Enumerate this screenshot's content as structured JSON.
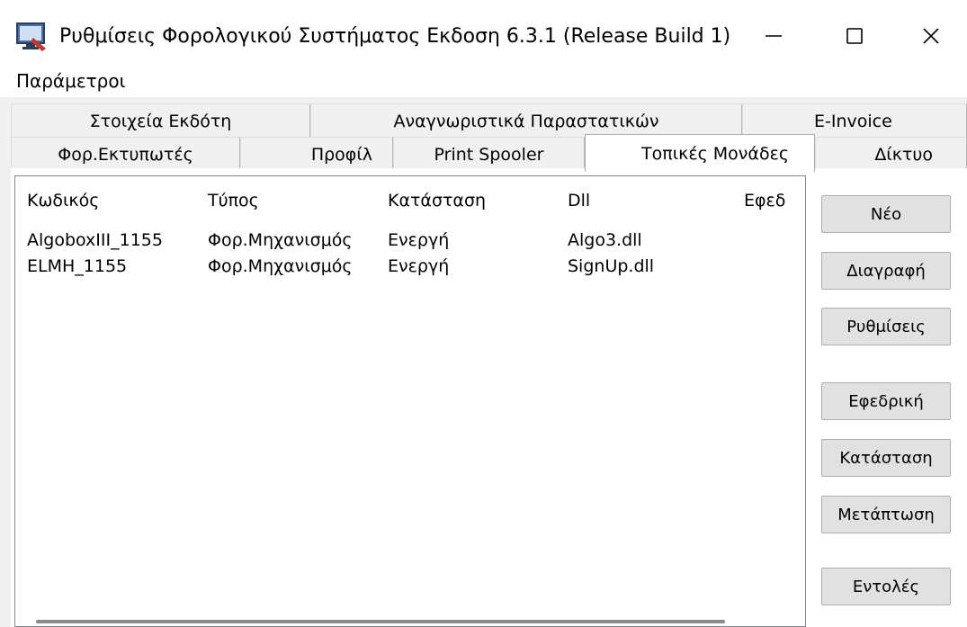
{
  "window": {
    "title": "Ρυθμίσεις Φορολογικού Συστήματος Εκδοση 6.3.1 (Release Build  1)",
    "app_icon": "monitor-settings-icon",
    "controls": {
      "minimize_icon": "minimize-icon",
      "maximize_icon": "maximize-icon",
      "close_icon": "close-icon"
    }
  },
  "menu": {
    "items": [
      "Παράμετροι"
    ]
  },
  "tabs": {
    "row1": [
      "Στοιχεία Εκδότη",
      "Αναγνωριστικά Παραστατικών",
      "E-Invoice"
    ],
    "row2": [
      "Φορ.Εκτυπωτές",
      "Προφίλ",
      "Print Spooler",
      "Τοπικές Μονάδες",
      "Δίκτυο"
    ],
    "active": "Τοπικές Μονάδες"
  },
  "table": {
    "columns": [
      "Κωδικός",
      "Τύπος",
      "Κατάσταση",
      "Dll",
      "Εφεδ"
    ],
    "rows": [
      [
        "AlgoboxIII_1155",
        "Φορ.Μηχανισμός",
        "Ενεργή",
        "Algo3.dll"
      ],
      [
        "ELMH_1155",
        "Φορ.Μηχανισμός",
        "Ενεργή",
        "SignUp.dll"
      ]
    ]
  },
  "buttons": {
    "new": "Νέο",
    "delete": "Διαγραφή",
    "settings": "Ρυθμίσεις",
    "backup": "Εφεδρική",
    "status": "Κατάσταση",
    "switch": "Μετάπτωση",
    "commands": "Εντολές"
  },
  "colors": {
    "window_bg": "#f0f0f0",
    "active_tab_bg": "#ffffff",
    "button_bg": "#e1e1e1",
    "border": "#adadad"
  }
}
